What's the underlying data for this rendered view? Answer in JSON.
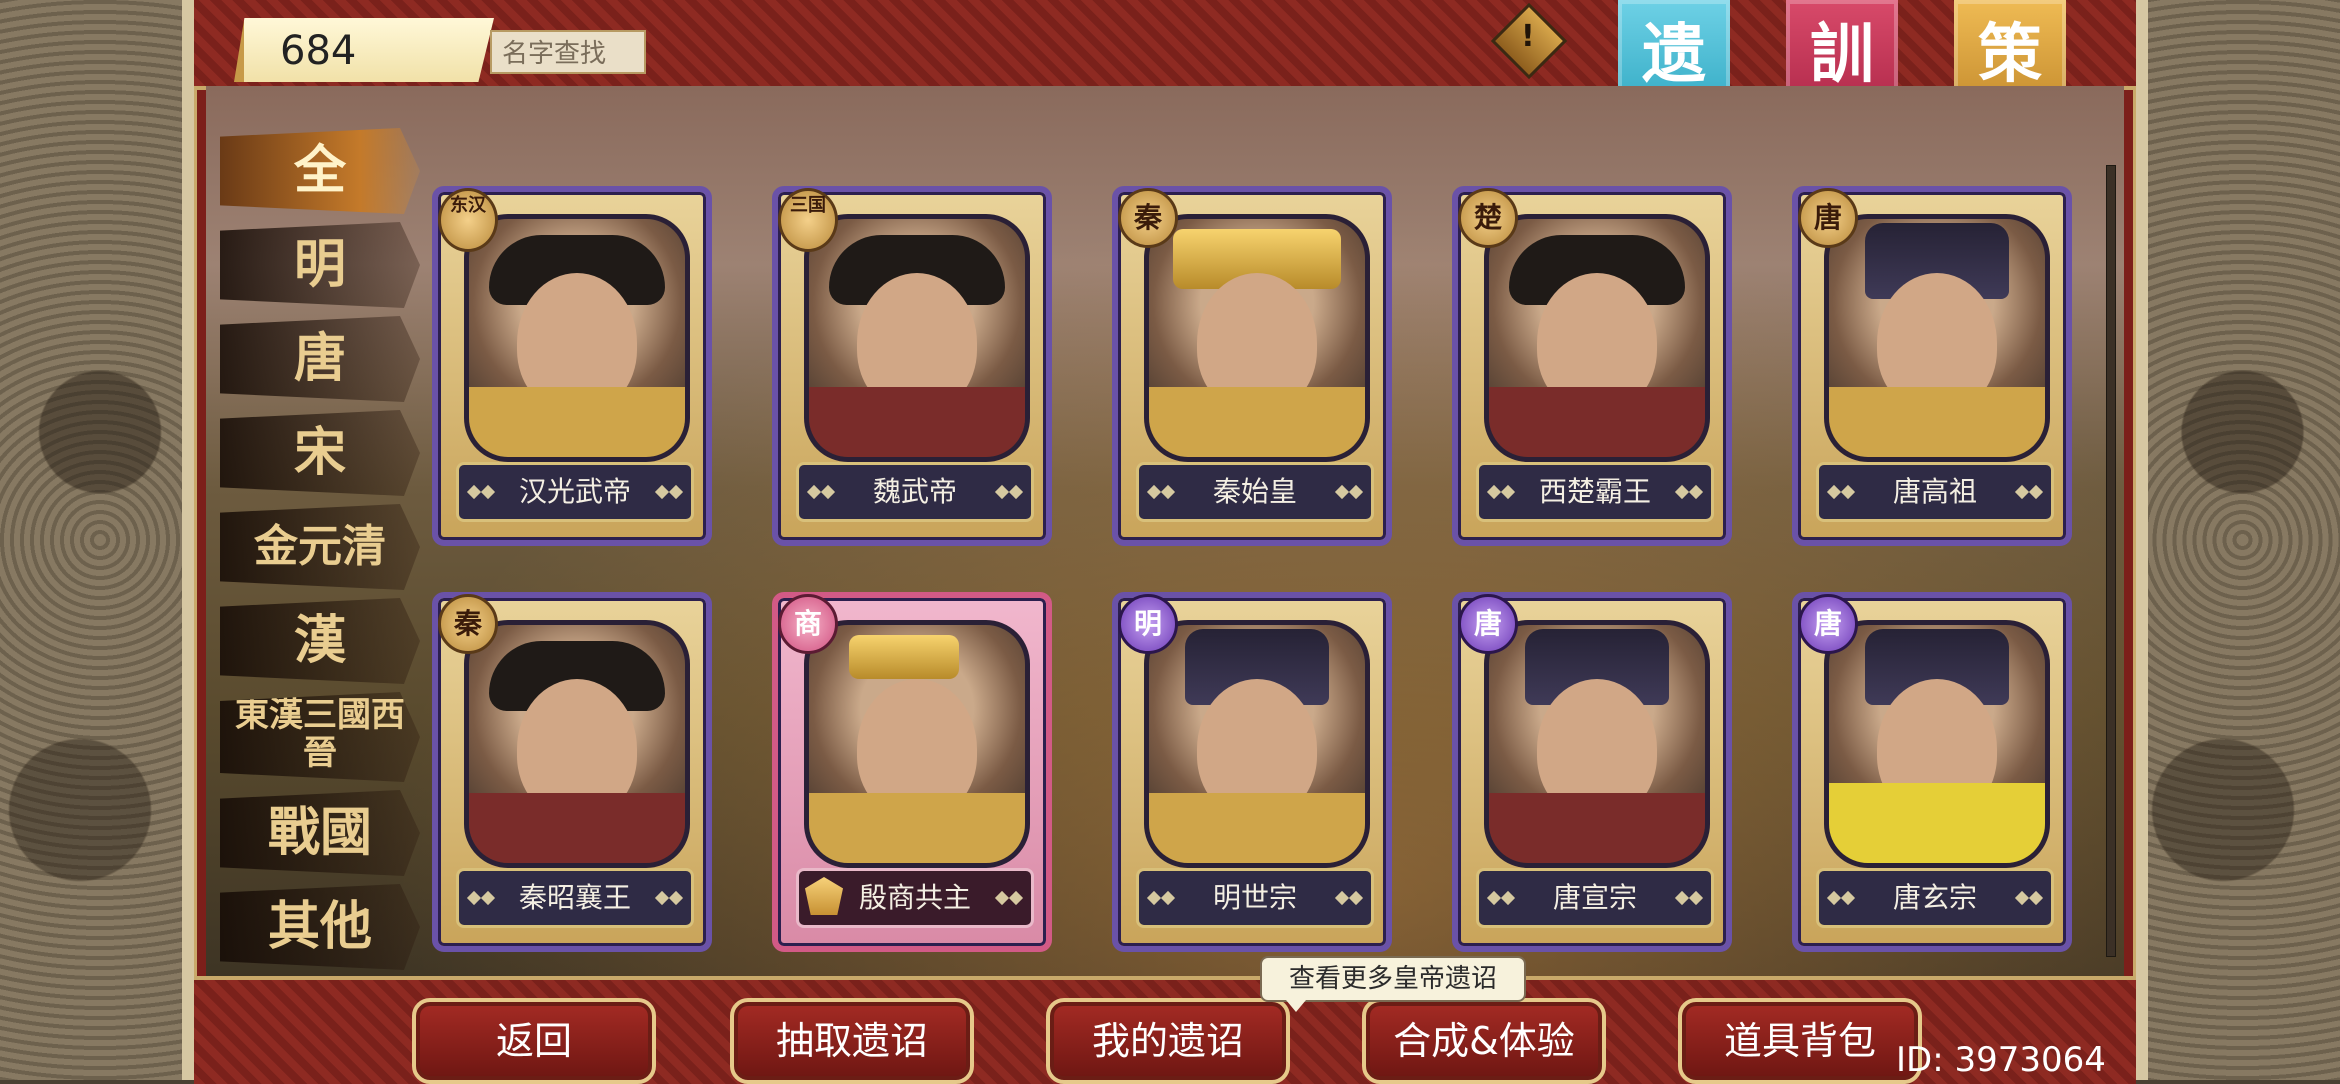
{
  "topbar": {
    "count": "684",
    "search_placeholder": "名字查找",
    "flags": [
      "遗",
      "訓",
      "策"
    ],
    "alert_icon": "alert-icon"
  },
  "categories": [
    "全",
    "明",
    "唐",
    "宋",
    "金元清",
    "漢",
    "東漢三國西晉",
    "戰國",
    "其他"
  ],
  "cards": [
    {
      "badge": "东汉",
      "name": "汉光武帝"
    },
    {
      "badge": "三国",
      "name": "魏武帝"
    },
    {
      "badge": "秦",
      "name": "秦始皇"
    },
    {
      "badge": "楚",
      "name": "西楚霸王"
    },
    {
      "badge": "唐",
      "name": "唐高祖"
    },
    {
      "badge": "秦",
      "name": "秦昭襄王"
    },
    {
      "badge": "商",
      "name": "殷商共主"
    },
    {
      "badge": "明",
      "name": "明世宗"
    },
    {
      "badge": "唐",
      "name": "唐宣宗"
    },
    {
      "badge": "唐",
      "name": "唐玄宗"
    }
  ],
  "bottom": {
    "buttons": [
      "返回",
      "抽取遗诏",
      "我的遗诏",
      "合成&体验",
      "道具背包"
    ],
    "tooltip": "查看更多皇帝遗诏",
    "id_text": "ID: 3973064"
  },
  "colors": {
    "panel_red": "#7c1f1a",
    "gold": "#c9a96a",
    "card_purple": "#6a52a8",
    "flag_blue": "#1f9db8",
    "flag_red": "#a21d3e",
    "flag_gold": "#b67b20"
  }
}
